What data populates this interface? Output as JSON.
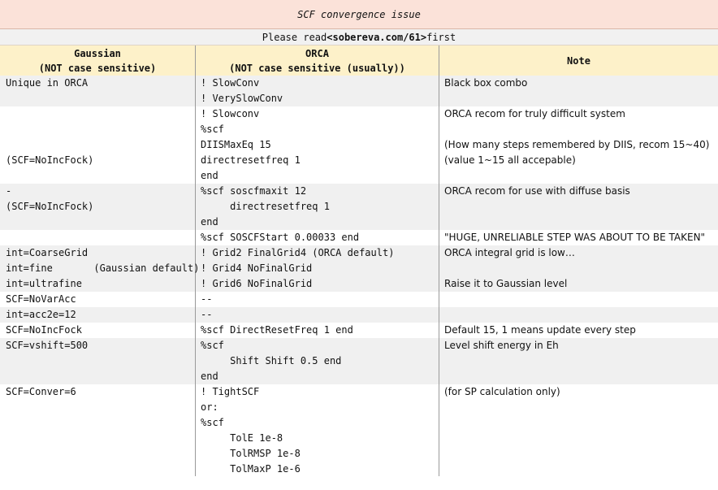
{
  "title": "SCF convergence issue",
  "subtitle": {
    "before": "Please read ",
    "link": "<sobereva.com/61>",
    "after": " first"
  },
  "headers": {
    "gaussian": {
      "line1": "Gaussian",
      "line2": "(NOT case sensitive)"
    },
    "orca": {
      "line1": "ORCA",
      "line2": "(NOT case sensitive (usually))"
    },
    "note": {
      "line1": "Note"
    }
  },
  "rows": [
    {
      "gaussian": "Unique in ORCA",
      "orca": "! SlowConv",
      "note": "Black box combo"
    },
    {
      "gaussian": "",
      "orca": "! VerySlowConv",
      "note": ""
    },
    {
      "gaussian": "",
      "orca": "! Slowconv",
      "note": "ORCA recom for truly difficult system"
    },
    {
      "gaussian": "",
      "orca": "%scf",
      "note": ""
    },
    {
      "gaussian": "",
      "orca": "DIISMaxEq 15",
      "note": "(How many steps remembered by DIIS, recom 15~40)"
    },
    {
      "gaussian": "(SCF=NoIncFock)",
      "orca": "directresetfreq 1",
      "note": "(value 1~15 all accepable)"
    },
    {
      "gaussian": "",
      "orca": "end",
      "note": ""
    },
    {
      "gaussian": "-",
      "orca": "%scf soscfmaxit 12",
      "note": "ORCA recom for use with diffuse basis"
    },
    {
      "gaussian": "(SCF=NoIncFock)",
      "orca": "     directresetfreq 1",
      "note": ""
    },
    {
      "gaussian": "",
      "orca": "end",
      "note": ""
    },
    {
      "gaussian": "",
      "orca": "%scf SOSCFStart 0.00033 end",
      "note": "\"HUGE, UNRELIABLE STEP WAS ABOUT TO BE TAKEN\""
    },
    {
      "gaussian": "int=CoarseGrid",
      "orca": "! Grid2 FinalGrid4 (ORCA default)",
      "note": "ORCA integral grid is low…"
    },
    {
      "gaussian": "int=fine       (Gaussian default)",
      "orca": "! Grid4 NoFinalGrid",
      "note": ""
    },
    {
      "gaussian": "int=ultrafine",
      "orca": "! Grid6 NoFinalGrid",
      "note": "Raise it to Gaussian level"
    },
    {
      "gaussian": "SCF=NoVarAcc",
      "orca": "--",
      "note": ""
    },
    {
      "gaussian": "int=acc2e=12",
      "orca": "--",
      "note": ""
    },
    {
      "gaussian": "SCF=NoIncFock",
      "orca": "%scf DirectResetFreq 1 end",
      "note": "Default 15, 1 means update every step"
    },
    {
      "gaussian": "SCF=vshift=500",
      "orca": "%scf",
      "note": "Level shift energy in Eh"
    },
    {
      "gaussian": "",
      "orca": "     Shift Shift 0.5 end",
      "note": ""
    },
    {
      "gaussian": "",
      "orca": "end",
      "note": ""
    },
    {
      "gaussian": "SCF=Conver=6",
      "orca": "! TightSCF",
      "note": "(for SP calculation only)"
    },
    {
      "gaussian": "",
      "orca": "or:",
      "note": ""
    },
    {
      "gaussian": "",
      "orca": "%scf",
      "note": ""
    },
    {
      "gaussian": "",
      "orca": "     TolE 1e-8",
      "note": ""
    },
    {
      "gaussian": "",
      "orca": "     TolRMSP 1e-8",
      "note": ""
    },
    {
      "gaussian": "",
      "orca": "     TolMaxP 1e-6",
      "note": ""
    }
  ]
}
